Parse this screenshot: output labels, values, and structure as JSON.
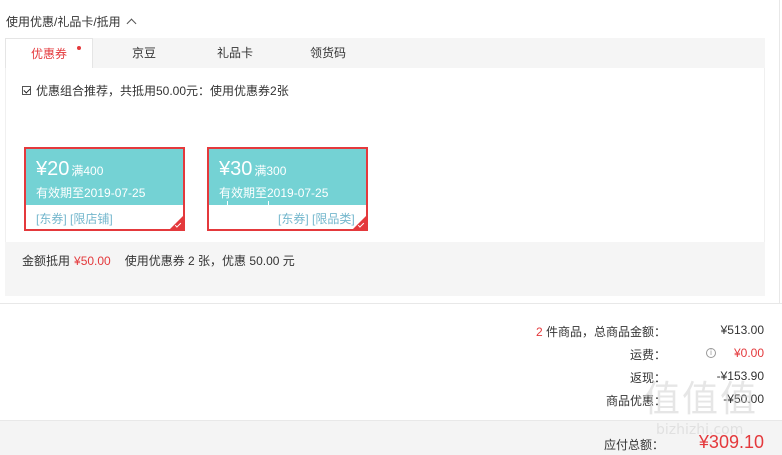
{
  "section": {
    "title": "使用优惠/礼品卡/抵用"
  },
  "tabs": [
    {
      "label": "优惠券",
      "active": true
    },
    {
      "label": "京豆",
      "active": false
    },
    {
      "label": "礼品卡",
      "active": false
    },
    {
      "label": "领货码",
      "active": false
    }
  ],
  "recommend": {
    "text": "优惠组合推荐，共抵用50.00元：使用优惠券2张",
    "checked": true
  },
  "coupons": [
    {
      "amount": "¥20",
      "condition": "满400",
      "valid": "有效期至2019-07-25",
      "tags": "[东券] [限店铺]",
      "selected": true
    },
    {
      "amount": "¥30",
      "condition": "满300",
      "valid": "有效期至2019-07-25",
      "tags": "[东券] [限品类]",
      "selected": true
    }
  ],
  "summary": {
    "deduct_label": "金额抵用",
    "deduct_value": "¥50.00",
    "detail": "使用优惠券 2 张，优惠 50.00 元"
  },
  "order": {
    "count": "2",
    "count_label": "件商品，总商品金额：",
    "goods_total": "¥513.00",
    "freight_label": "运费：",
    "freight_value": "¥0.00",
    "cashback_label": "返现：",
    "cashback_value": "-¥153.90",
    "discount_label": "商品优惠：",
    "discount_value": "-¥50.00",
    "payable_label": "应付总额：",
    "payable_value": "¥309.10"
  },
  "watermark": {
    "glyphs": "值值值",
    "sub": "bizhizhi.com"
  },
  "colors": {
    "accent": "#e4393c",
    "coupon_bg": "#74d2d4",
    "tag": "#74b7cd"
  }
}
